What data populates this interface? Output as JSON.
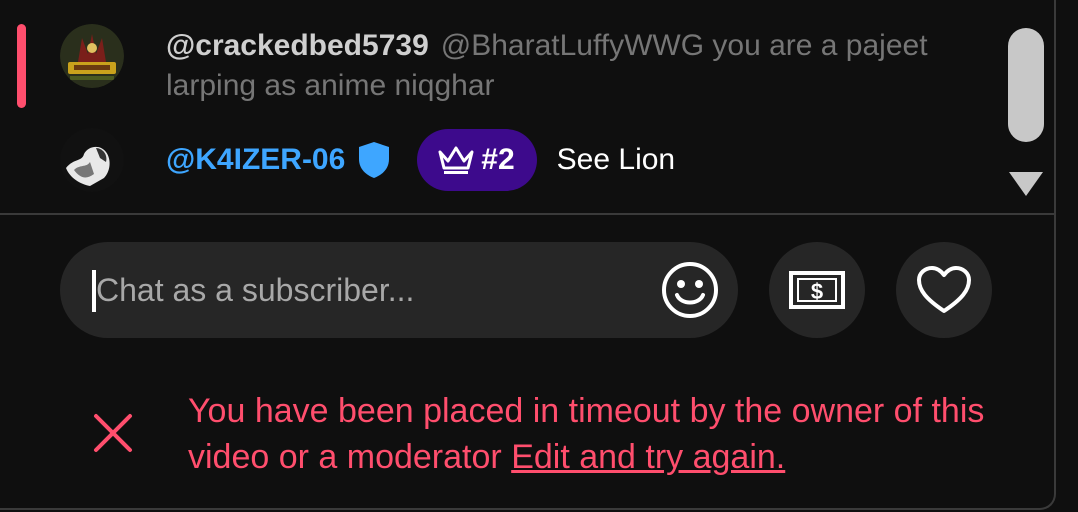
{
  "messages": [
    {
      "author": "@crackedbed5739",
      "text": "@BharatLuffyWWG you are a pajeet larping as anime niqghar",
      "avatar_icon": "avatar-image"
    },
    {
      "author": "@K4IZER-06",
      "verified_icon": "shield-icon",
      "badge": {
        "icon": "crown-icon",
        "rank": "#2",
        "color": "#3d0a8c"
      },
      "text": "See Lion",
      "avatar_icon": "avatar-image"
    }
  ],
  "chat_input": {
    "placeholder": "Chat as a subscriber...",
    "emoji_icon": "smiley-icon"
  },
  "actions": {
    "super_chat_icon": "dollar-bill-icon",
    "heart_icon": "heart-icon"
  },
  "error": {
    "message": "You have been placed in timeout by the owner of this video or a moderator",
    "link": "Edit and try again.",
    "color": "#ff4e6d"
  },
  "colors": {
    "background": "#0f0f0f",
    "accent_red": "#ff4e6d",
    "link_blue": "#3ea6ff",
    "member_purple": "#3d0a8c"
  }
}
